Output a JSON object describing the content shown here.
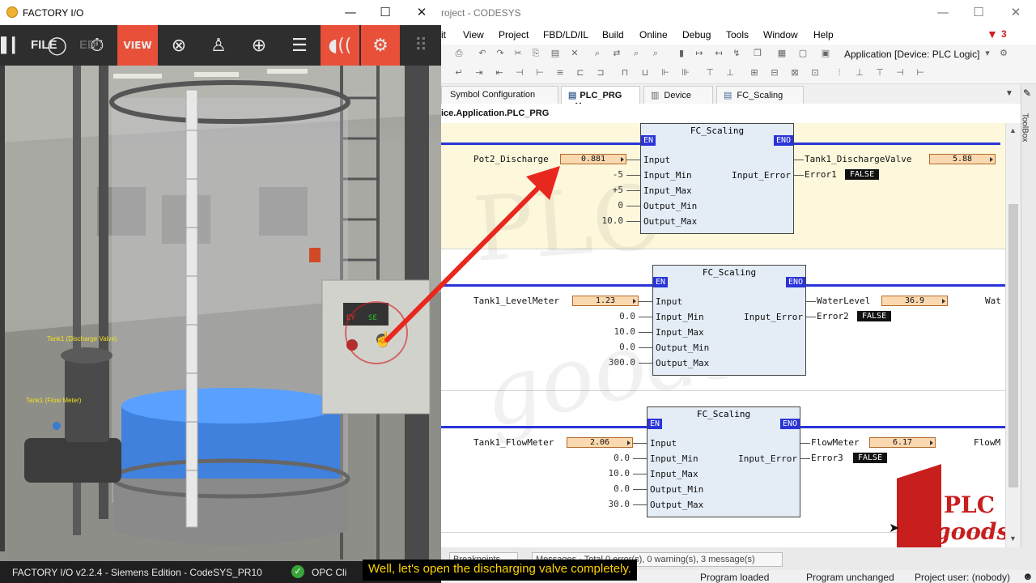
{
  "factory_io": {
    "title": "FACTORY I/O",
    "toolbar": {
      "file_label": "FILE",
      "edit_label": "ED",
      "view_label": "VIEW"
    },
    "scene": {
      "sensor_label_1": "Tank1 (Discharge Valve)",
      "sensor_label_2": "Tank1 (Flow Meter)",
      "panel_digit_1": "EY",
      "panel_digit_2": "SE"
    },
    "status": {
      "version": "FACTORY I/O v2.2.4 - Siemens Edition - CodeSYS_PR10",
      "driver": "OPC Cli"
    }
  },
  "codesys": {
    "title": "roject - CODESYS",
    "error_badge": "3",
    "menu": [
      "it",
      "View",
      "Project",
      "FBD/LD/IL",
      "Build",
      "Online",
      "Debug",
      "Tools",
      "Window",
      "Help"
    ],
    "device_selector": "Application [Device: PLC Logic]",
    "tabs": [
      {
        "label": "Symbol Configuration"
      },
      {
        "label": "PLC_PRG"
      },
      {
        "label": "Device"
      },
      {
        "label": "FC_Scaling"
      }
    ],
    "path": "ice.Application.PLC_PRG",
    "toolbox_label": "ToolBox",
    "networks": [
      {
        "block": "FC_Scaling",
        "en": "EN",
        "eno": "ENO",
        "in_var": "Pot2_Discharge",
        "in_val": "0.881",
        "inputs": [
          "Input",
          "Input_Min",
          "Input_Max",
          "Output_Min",
          "Output_Max"
        ],
        "consts": [
          "-5",
          "+5",
          "0",
          "10.0"
        ],
        "out_pin": "Input_Error",
        "out_var": "Tank1_DischargeValve",
        "out_val": "5.88",
        "err_var": "Error1",
        "err_val": "FALSE"
      },
      {
        "block": "FC_Scaling",
        "en": "EN",
        "eno": "ENO",
        "in_var": "Tank1_LevelMeter",
        "in_val": "1.23",
        "inputs": [
          "Input",
          "Input_Min",
          "Input_Max",
          "Output_Min",
          "Output_Max"
        ],
        "consts": [
          "0.0",
          "10.0",
          "0.0",
          "300.0"
        ],
        "out_pin": "Input_Error",
        "out_var": "WaterLevel",
        "out_val": "36.9",
        "out_extra": "Wat",
        "err_var": "Error2",
        "err_val": "FALSE"
      },
      {
        "block": "FC_Scaling",
        "en": "EN",
        "eno": "ENO",
        "in_var": "Tank1_FlowMeter",
        "in_val": "2.06",
        "inputs": [
          "Input",
          "Input_Min",
          "Input_Max",
          "Output_Min",
          "Output_Max"
        ],
        "consts": [
          "0.0",
          "10.0",
          "0.0",
          "30.0"
        ],
        "out_pin": "Input_Error",
        "out_var": "FlowMeter",
        "out_val": "6.17",
        "out_extra": "FlowM",
        "err_var": "Error3",
        "err_val": "FALSE"
      }
    ],
    "msg_tabs": {
      "breakpoints": "Breakpoints",
      "messages": "Messages - Total 0 error(s), 0 warning(s), 3 message(s)"
    },
    "status": {
      "loaded": "Program loaded",
      "unchanged": "Program unchanged",
      "user": "Project user: (nobody)"
    }
  },
  "watermark": {
    "brand_top": "PLC",
    "brand_bottom": "goods"
  },
  "subtitle": "Well, let's open the discharging valve completely.",
  "colors": {
    "accent_orange": "#e8503a",
    "rail_blue": "#2a34d8",
    "value_box": "#fbd9b0",
    "arrow_red": "#e8281e",
    "subtitle_text": "#ffd400"
  }
}
